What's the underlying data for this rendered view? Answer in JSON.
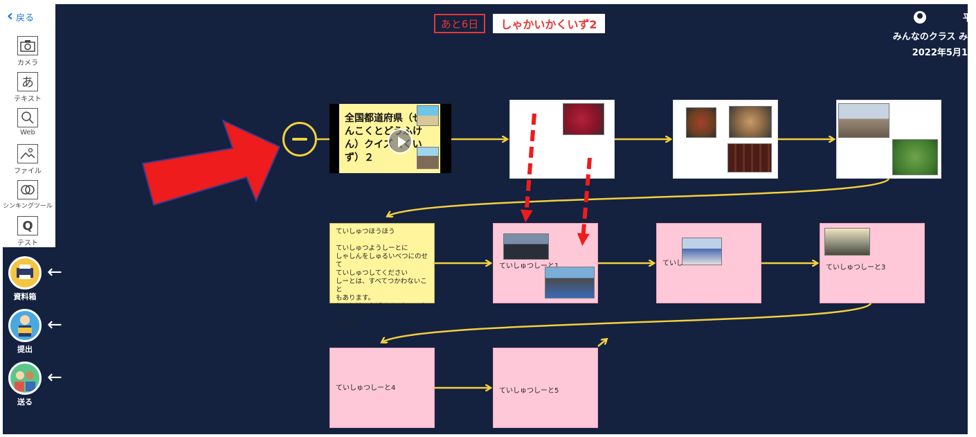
{
  "toolbar": {
    "back_label": "戻る",
    "tools": [
      {
        "icon": "camera-icon",
        "label": "カメラ"
      },
      {
        "icon": "text-icon",
        "glyph": "あ",
        "label": "テキスト"
      },
      {
        "icon": "web-search-icon",
        "label": "Web"
      },
      {
        "icon": "file-image-icon",
        "label": "ファイル"
      },
      {
        "icon": "thinking-tool-icon",
        "label": "シンキングツール"
      },
      {
        "icon": "test-icon",
        "glyph": "Q",
        "label": "テスト"
      }
    ],
    "round_buttons": [
      {
        "icon": "printer-icon",
        "label": "資料箱",
        "color": "#f4c542"
      },
      {
        "icon": "submit-person-icon",
        "label": "提出",
        "color": "#4aa8e0"
      },
      {
        "icon": "send-people-icon",
        "label": "送る",
        "color": "#5cc58a"
      }
    ]
  },
  "header": {
    "days_left": "あと6日",
    "task_title": "しゃかいかくいず2"
  },
  "user": {
    "name_initial": "平",
    "class_name": "みんなのクラス み",
    "date": "2022年5月1"
  },
  "cards": {
    "quiz": {
      "title": "全国都道府県（ぜんこくとどうふけん）クイズ（くいず）２"
    },
    "note": {
      "text": "ていしゅつほうほう\n\nていしゅつようしーとに\nしゃしんをしゅるいべつにのせて\nていしゅつしてください\nしーとは、すべてつかわないこと\nもあります。\nしーとはつなげてていしゅつして\nください"
    },
    "sheet1": {
      "label": "ていしゅつしーと1"
    },
    "sheet2": {
      "label": "ていし"
    },
    "sheet3": {
      "label": "ていしゅつしーと3"
    },
    "sheet4": {
      "label": "ていしゅつしーと4"
    },
    "sheet5": {
      "label": "ていしゅつしーと5"
    }
  },
  "colors": {
    "canvas": "#14213f",
    "connector": "#f4d03f",
    "annotation": "#ee1c1c",
    "pink_card": "#ffc8d8",
    "note_card": "#fff59d"
  }
}
